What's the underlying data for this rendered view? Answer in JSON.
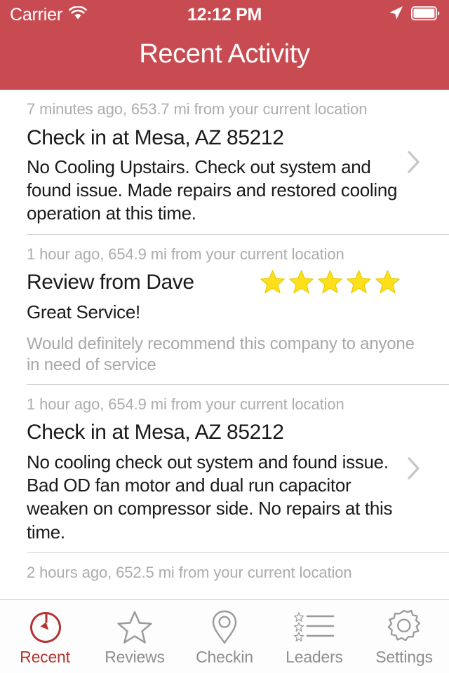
{
  "theme": {
    "brand_red": "#C94B52",
    "active_red": "#B5332F",
    "star_yellow": "#FDE01A",
    "meta_gray": "#ACACAC",
    "chevron_gray": "#C7C7CC"
  },
  "status_bar": {
    "carrier": "Carrier",
    "wifi_icon": "wifi-icon",
    "time": "12:12 PM",
    "location_icon": "location-arrow-icon",
    "battery_icon": "battery-full-icon"
  },
  "nav": {
    "title": "Recent Activity"
  },
  "activity": {
    "rows": [
      {
        "meta": "7 minutes ago, 653.7 mi from your current location",
        "title": "Check in at Mesa, AZ 85212",
        "body": "No Cooling Upstairs. Check out system and found issue. Made repairs and restored cooling operation at this time.",
        "has_chevron": true,
        "stars": 0,
        "subtle": ""
      },
      {
        "meta": "1 hour ago, 654.9 mi from your current location",
        "title": "Review from Dave",
        "body": "Great Service!",
        "has_chevron": false,
        "stars": 5,
        "subtle": "Would definitely recommend this company to anyone in need of service"
      },
      {
        "meta": "1 hour ago, 654.9 mi from your current location",
        "title": "Check in at Mesa, AZ 85212",
        "body": "No cooling check out system and found issue. Bad OD fan motor and dual run capacitor weaken on compressor side. No repairs at this time.",
        "has_chevron": true,
        "stars": 0,
        "subtle": ""
      },
      {
        "meta": "2 hours ago, 652.5 mi from your current location",
        "title": "",
        "body": "",
        "has_chevron": false,
        "stars": 0,
        "subtle": ""
      }
    ]
  },
  "tabbar": {
    "items": [
      {
        "label": "Recent",
        "icon": "timer-icon",
        "active": true
      },
      {
        "label": "Reviews",
        "icon": "star-icon",
        "active": false
      },
      {
        "label": "Checkin",
        "icon": "map-pin-icon",
        "active": false
      },
      {
        "label": "Leaders",
        "icon": "star-list-icon",
        "active": false
      },
      {
        "label": "Settings",
        "icon": "gear-icon",
        "active": false
      }
    ]
  }
}
